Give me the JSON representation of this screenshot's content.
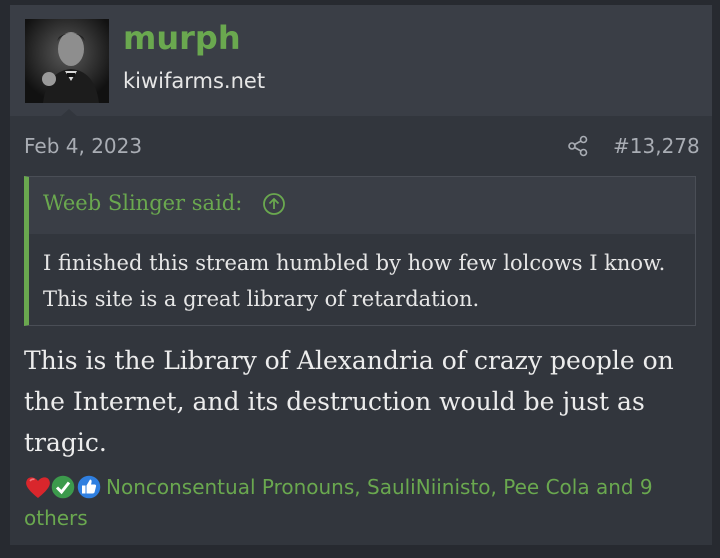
{
  "user": {
    "name": "murph",
    "title": "kiwifarms.net"
  },
  "post": {
    "date": "Feb 4, 2023",
    "number": "#13,278",
    "quote": {
      "author_line": "Weeb Slinger said:",
      "text": "I finished this stream humbled by how few lolcows I know. This site is a great library of retardation."
    },
    "message": "This is the Library of Alexandria of crazy people on the Internet, and its destruction would be just as tragic.",
    "reactions": {
      "text": "Nonconsentual Pronouns, SauliNiinisto, Pee Cola and 9 others",
      "icons": [
        "heart-icon",
        "check-icon",
        "thumbs-up-icon"
      ]
    }
  },
  "colors": {
    "page_bg": "#272a30",
    "post_bg": "#32363d",
    "header_bg": "#3a3e46",
    "accent": "#6aa84f",
    "muted_text": "#a9adb4"
  }
}
